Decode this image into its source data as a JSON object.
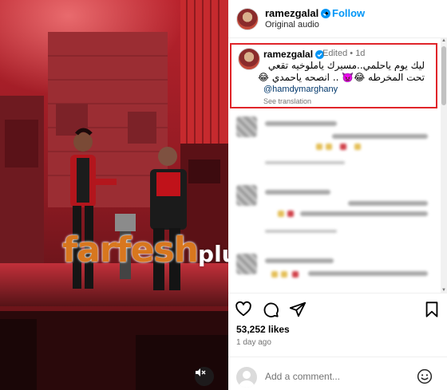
{
  "post": {
    "username": "ramezgalal",
    "follow_label": "Follow",
    "separator": "•",
    "audio": "Original audio"
  },
  "caption": {
    "username": "ramezgalal",
    "edited": "Edited",
    "separator": "•",
    "time": "1d",
    "line1": "ليك يوم ياحلمي..مسيرك ياملوخيه تقعي",
    "line2": "تحت المخرطه 😂👿 .. انصحه ياحمدي 😂",
    "mention": "@hamdymarghany",
    "see_translation": "See translation"
  },
  "actions": {
    "likes": "53,252 likes",
    "time_ago": "1 day ago"
  },
  "add_comment": {
    "placeholder": "Add a comment..."
  },
  "watermark": {
    "part1": "farfesh",
    "part2": "plus.com"
  },
  "icons": {
    "verified": "verified-badge-icon",
    "like": "heart-icon",
    "comment": "comment-icon",
    "share": "paper-plane-icon",
    "save": "bookmark-icon",
    "emoji": "smiley-icon",
    "mute": "speaker-muted-icon"
  },
  "colors": {
    "link_blue": "#0095f6",
    "verified_blue": "#0095f6",
    "highlight_red": "#e0252a",
    "mention_blue": "#00376b",
    "watermark_orange": "#d8771e"
  }
}
